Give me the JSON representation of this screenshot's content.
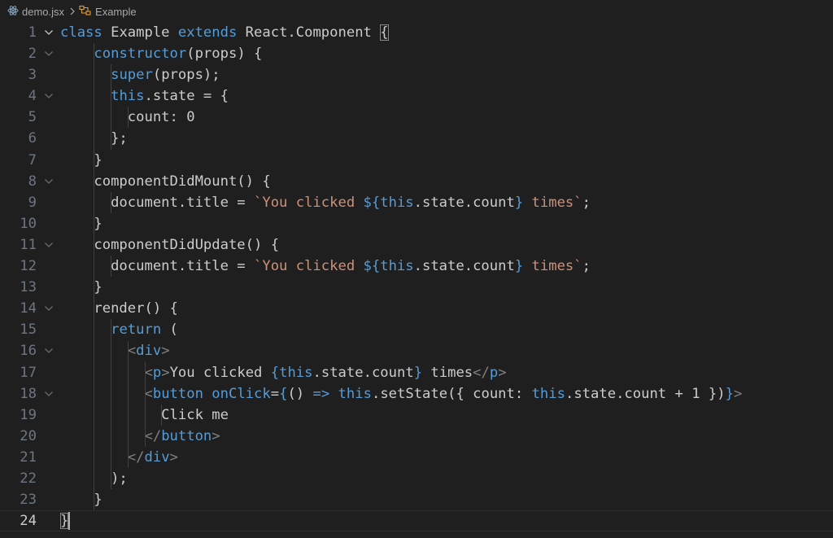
{
  "breadcrumb": {
    "file": "demo.jsx",
    "file_icon": "react-icon",
    "symbol": "Example",
    "symbol_icon": "class-icon",
    "separator_icon": "chevron-right-icon"
  },
  "colors": {
    "background": "#1f1f1f",
    "keyword": "#569cd6",
    "control_keyword": "#c586c0",
    "string": "#ce9178",
    "tag": "#569cd6",
    "tag_bracket": "#808080",
    "default_text": "#cccccc",
    "line_number": "#6e7681",
    "active_line_number": "#cccccc"
  },
  "editor": {
    "current_line": 24,
    "lines": [
      {
        "n": "1",
        "fold": true,
        "tokens": [
          [
            "class",
            "kw"
          ],
          [
            " Example ",
            "t"
          ],
          [
            "extends",
            "kw"
          ],
          [
            " React.Component ",
            "t"
          ],
          [
            "{",
            "t"
          ]
        ]
      },
      {
        "n": "2",
        "fold": true,
        "tokens": [
          [
            "    ",
            "t"
          ],
          [
            "constructor",
            "kw"
          ],
          [
            "(props) {",
            "t"
          ]
        ]
      },
      {
        "n": "3",
        "fold": false,
        "tokens": [
          [
            "      ",
            "t"
          ],
          [
            "super",
            "kw"
          ],
          [
            "(props);",
            "t"
          ]
        ]
      },
      {
        "n": "4",
        "fold": true,
        "tokens": [
          [
            "      ",
            "t"
          ],
          [
            "this",
            "kw"
          ],
          [
            ".state = {",
            "t"
          ]
        ]
      },
      {
        "n": "5",
        "fold": false,
        "tokens": [
          [
            "        count: 0",
            "t"
          ]
        ]
      },
      {
        "n": "6",
        "fold": false,
        "tokens": [
          [
            "      };",
            "t"
          ]
        ]
      },
      {
        "n": "7",
        "fold": false,
        "tokens": [
          [
            "    }",
            "t"
          ]
        ]
      },
      {
        "n": "8",
        "fold": true,
        "tokens": [
          [
            "    componentDidMount() {",
            "t"
          ]
        ]
      },
      {
        "n": "9",
        "fold": false,
        "tokens": [
          [
            "      document.title = ",
            "t"
          ],
          [
            "`You clicked ",
            "str"
          ],
          [
            "${",
            "kw"
          ],
          [
            "this",
            "kw"
          ],
          [
            ".state.count",
            "t"
          ],
          [
            "}",
            "kw"
          ],
          [
            " times`",
            "str"
          ],
          [
            ";",
            "t"
          ]
        ]
      },
      {
        "n": "10",
        "fold": false,
        "tokens": [
          [
            "    }",
            "t"
          ]
        ]
      },
      {
        "n": "11",
        "fold": true,
        "tokens": [
          [
            "    componentDidUpdate() {",
            "t"
          ]
        ]
      },
      {
        "n": "12",
        "fold": false,
        "tokens": [
          [
            "      document.title = ",
            "t"
          ],
          [
            "`You clicked ",
            "str"
          ],
          [
            "${",
            "kw"
          ],
          [
            "this",
            "kw"
          ],
          [
            ".state.count",
            "t"
          ],
          [
            "}",
            "kw"
          ],
          [
            " times`",
            "str"
          ],
          [
            ";",
            "t"
          ]
        ]
      },
      {
        "n": "13",
        "fold": false,
        "tokens": [
          [
            "    }",
            "t"
          ]
        ]
      },
      {
        "n": "14",
        "fold": true,
        "tokens": [
          [
            "    render() {",
            "t"
          ]
        ]
      },
      {
        "n": "15",
        "fold": false,
        "tokens": [
          [
            "      ",
            "t"
          ],
          [
            "return",
            "kw"
          ],
          [
            " (",
            "t"
          ]
        ]
      },
      {
        "n": "16",
        "fold": true,
        "tokens": [
          [
            "        ",
            "t"
          ],
          [
            "<",
            "br"
          ],
          [
            "div",
            "tag"
          ],
          [
            ">",
            "br"
          ]
        ]
      },
      {
        "n": "17",
        "fold": false,
        "tokens": [
          [
            "          ",
            "t"
          ],
          [
            "<",
            "br"
          ],
          [
            "p",
            "tag"
          ],
          [
            ">",
            "br"
          ],
          [
            "You clicked ",
            "t"
          ],
          [
            "{",
            "kw"
          ],
          [
            "this",
            "kw"
          ],
          [
            ".state.count",
            "t"
          ],
          [
            "}",
            "kw"
          ],
          [
            " times",
            "t"
          ],
          [
            "</",
            "br"
          ],
          [
            "p",
            "tag"
          ],
          [
            ">",
            "br"
          ]
        ]
      },
      {
        "n": "18",
        "fold": true,
        "tokens": [
          [
            "          ",
            "t"
          ],
          [
            "<",
            "br"
          ],
          [
            "button",
            "tag"
          ],
          [
            " ",
            "t"
          ],
          [
            "onClick",
            "kw"
          ],
          [
            "=",
            "t"
          ],
          [
            "{",
            "kw"
          ],
          [
            "() ",
            "t"
          ],
          [
            "=>",
            "kw"
          ],
          [
            " ",
            "t"
          ],
          [
            "this",
            "kw"
          ],
          [
            ".setState({ count: ",
            "t"
          ],
          [
            "this",
            "kw"
          ],
          [
            ".state.count + 1 })",
            "t"
          ],
          [
            "}",
            "kw"
          ],
          [
            ">",
            "br"
          ]
        ]
      },
      {
        "n": "19",
        "fold": false,
        "tokens": [
          [
            "            Click me",
            "t"
          ]
        ]
      },
      {
        "n": "20",
        "fold": false,
        "tokens": [
          [
            "          ",
            "t"
          ],
          [
            "</",
            "br"
          ],
          [
            "button",
            "tag"
          ],
          [
            ">",
            "br"
          ]
        ]
      },
      {
        "n": "21",
        "fold": false,
        "tokens": [
          [
            "        ",
            "t"
          ],
          [
            "</",
            "br"
          ],
          [
            "div",
            "tag"
          ],
          [
            ">",
            "br"
          ]
        ]
      },
      {
        "n": "22",
        "fold": false,
        "tokens": [
          [
            "      );",
            "t"
          ]
        ]
      },
      {
        "n": "23",
        "fold": false,
        "tokens": [
          [
            "    }",
            "t"
          ]
        ]
      },
      {
        "n": "24",
        "fold": false,
        "tokens": [
          [
            "}",
            "t"
          ]
        ]
      }
    ]
  }
}
